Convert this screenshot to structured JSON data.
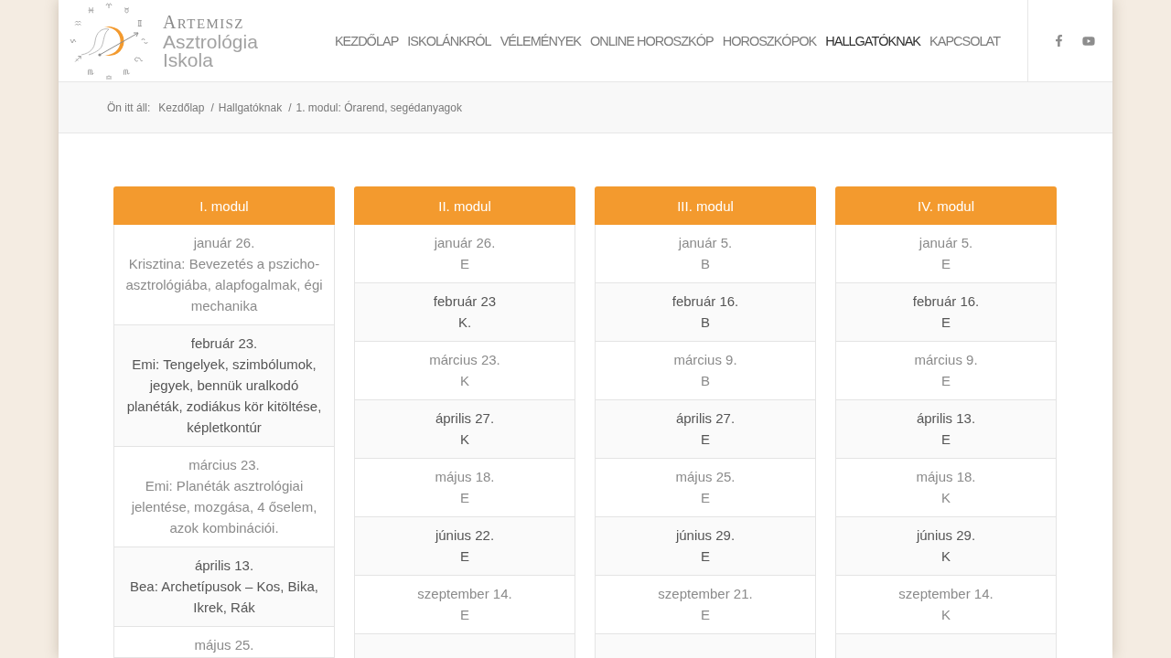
{
  "logo": {
    "title": "ARTEMISZ",
    "subtitle": [
      "Asztrológia",
      "Iskola"
    ]
  },
  "nav": [
    {
      "label": "KEZDŐLAP",
      "selected": false
    },
    {
      "label": "ISKOLÁNKRÓL",
      "selected": false
    },
    {
      "label": "VÉLEMÉNYEK",
      "selected": false
    },
    {
      "label": "ONLINE HOROSZKÓP",
      "selected": false
    },
    {
      "label": "HOROSZKÓPOK",
      "selected": false
    },
    {
      "label": "HALLGATÓKNAK",
      "selected": true
    },
    {
      "label": "KAPCSOLAT",
      "selected": false
    }
  ],
  "breadcrumb": {
    "label": "Ön itt áll:",
    "items": [
      {
        "text": "Kezdőlap"
      },
      {
        "separator": "/",
        "text": "Hallgatóknak"
      },
      {
        "separator": "/",
        "text": "1. modul: Órarend, segédanyagok"
      }
    ]
  },
  "modules": [
    {
      "title": "I. modul",
      "sessions": [
        {
          "date": "január 26.",
          "detail": "Krisztina: Bevezetés a pszicho-asztrológiába, alapfogalmak, égi mechanika"
        },
        {
          "date": "február 23.",
          "detail": "Emi: Tengelyek, szimbólumok, jegyek, bennük uralkodó planéták, zodiákus kör kitöltése, képletkontúr"
        },
        {
          "date": "március 23.",
          "detail": "Emi: Planéták asztrológiai jelentése, mozgása, 4 őselem, azok kombinációi."
        },
        {
          "date": "április 13.",
          "detail": "Bea: Archetípusok – Kos, Bika, Ikrek, Rák"
        },
        {
          "date": "május 25."
        }
      ]
    },
    {
      "title": "II. modul",
      "sessions": [
        {
          "date": "január 26.",
          "detail": "E"
        },
        {
          "date": "február 23",
          "detail": "K."
        },
        {
          "date": "március 23.",
          "detail": "K"
        },
        {
          "date": "április 27.",
          "detail": "K"
        },
        {
          "date": "május 18.",
          "detail": "E"
        },
        {
          "date": "június 22.",
          "detail": "E"
        },
        {
          "date": "szeptember 14.",
          "detail": "E"
        }
      ]
    },
    {
      "title": "III. modul",
      "sessions": [
        {
          "date": "január 5.",
          "detail": "B"
        },
        {
          "date": "február 16.",
          "detail": "B"
        },
        {
          "date": "március 9.",
          "detail": "B"
        },
        {
          "date": "április 27.",
          "detail": "E"
        },
        {
          "date": "május 25.",
          "detail": "E"
        },
        {
          "date": "június 29.",
          "detail": "E"
        },
        {
          "date": "szeptember 21.",
          "detail": "E"
        }
      ]
    },
    {
      "title": "IV. modul",
      "sessions": [
        {
          "date": "január 5.",
          "detail": "E"
        },
        {
          "date": "február 16.",
          "detail": "E"
        },
        {
          "date": "március 9.",
          "detail": "E"
        },
        {
          "date": "április 13.",
          "detail": "E"
        },
        {
          "date": "május 18.",
          "detail": "K"
        },
        {
          "date": "június 29.",
          "detail": "K"
        },
        {
          "date": "szeptember 14.",
          "detail": "K"
        }
      ]
    }
  ]
}
